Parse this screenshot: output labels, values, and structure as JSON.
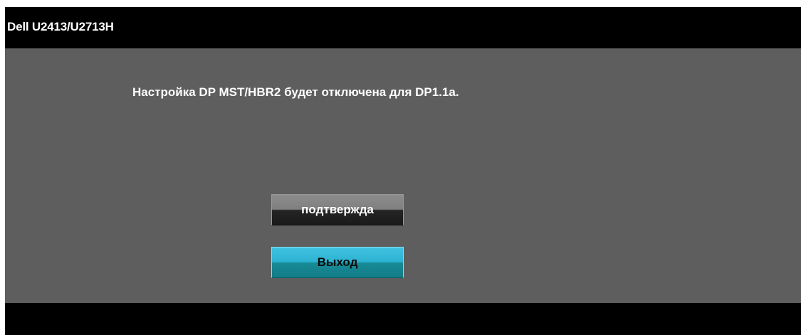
{
  "window": {
    "title": "Dell U2413/U2713H"
  },
  "dialog": {
    "message": "Настройка DP MST/HBR2 будет отключена для DP1.1a."
  },
  "buttons": {
    "confirm_label": "подтвержда",
    "exit_label": "Выход"
  },
  "colors": {
    "panel_background": "#5e5e5e",
    "bar_background": "#000000",
    "confirm_button": "#242424",
    "exit_button": "#2db3d2"
  }
}
